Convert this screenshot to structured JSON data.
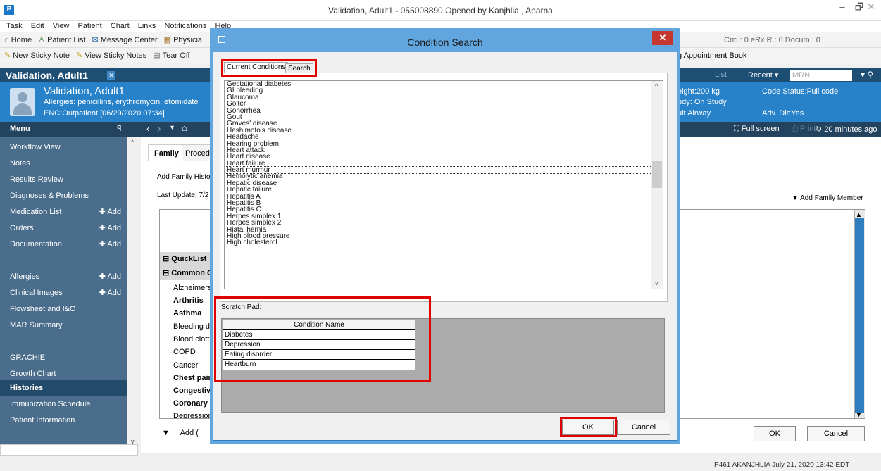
{
  "window": {
    "title": "Validation, Adult1 - 055008890 Opened by Kanjhlia , Aparna",
    "logo": "P",
    "minimize": "–",
    "restore": "🗗",
    "close": "✕"
  },
  "menubar": [
    "Task",
    "Edit",
    "View",
    "Patient",
    "Chart",
    "Links",
    "Notifications",
    "Help"
  ],
  "toolbar1": [
    "Home",
    "Patient List",
    "Message Center",
    "Physicia"
  ],
  "toolbar1_right": {
    "counts": "Criti.: 0  eRx R.: 0  Docum.: 0"
  },
  "toolbar2": [
    "New Sticky Note",
    "View Sticky Notes",
    "Tear Off"
  ],
  "toolbar2_right": "g Appointment Book",
  "patient": {
    "tab_name": "Validation, Adult1",
    "name": "Validation, Adult1",
    "allergies": "Allergies: penicillins, erythromycin, etomidate",
    "encounter": "ENC:Outpatient [06/29/2020 07:34]",
    "weight": "eight:200 kg",
    "study": "udy: On Study",
    "airway": "ult Airway",
    "code_status": "Code Status:Full code",
    "adv_dir": "Adv. Dir:Yes"
  },
  "search": {
    "list_label": "List",
    "recent_label": "Recent",
    "mrn_placeholder": "MRN"
  },
  "navbar": {
    "menu_label": "Menu",
    "fullscreen": "Full screen",
    "print": "Print",
    "refresh": "20 minutes ago"
  },
  "sidebar": [
    {
      "label": "Workflow View",
      "add": ""
    },
    {
      "label": "Notes",
      "add": ""
    },
    {
      "label": "Results Review",
      "add": ""
    },
    {
      "label": "Diagnoses & Problems",
      "add": ""
    },
    {
      "label": "Medication List",
      "add": "Add"
    },
    {
      "label": "Orders",
      "add": "Add"
    },
    {
      "label": "Documentation",
      "add": "Add"
    },
    {
      "label": "",
      "add": ""
    },
    {
      "label": "Allergies",
      "add": "Add"
    },
    {
      "label": "Clinical Images",
      "add": "Add"
    },
    {
      "label": "Flowsheet and I&O",
      "add": ""
    },
    {
      "label": "MAR Summary",
      "add": ""
    },
    {
      "label": "",
      "add": ""
    },
    {
      "label": "GRACHIE",
      "add": ""
    },
    {
      "label": "Growth Chart",
      "add": ""
    },
    {
      "label": "Histories",
      "add": "",
      "active": true
    },
    {
      "label": "Immunization Schedule",
      "add": ""
    },
    {
      "label": "Patient Information",
      "add": ""
    }
  ],
  "content": {
    "tabs": [
      "Family",
      "Proced"
    ],
    "add_history": "Add Family Histor",
    "last_update": "Last Update: 7/2",
    "add_member": "Add Family Member",
    "quicklist": "QuickList",
    "common": "Common C",
    "conditions": [
      "Alzheimers",
      "Arthritis",
      "Asthma",
      "Bleeding di",
      "Blood clott",
      "COPD",
      "Cancer",
      "Chest pain",
      "Congestive",
      "Coronary a",
      "Depression"
    ],
    "add_bottom": "Add (",
    "ok": "OK",
    "cancel": "Cancel"
  },
  "dialog": {
    "title": "Condition Search",
    "close": "✕",
    "tabs": [
      "Current Conditions",
      "Search"
    ],
    "conditions": [
      "Gestational diabetes",
      "GI bleeding",
      "Glaucoma",
      "Goiter",
      "Gonorrhea",
      "Gout",
      "Graves' disease",
      "Hashimoto's disease",
      "Headache",
      "Hearing problem",
      "Heart attack",
      "Heart disease",
      "Heart failure",
      "Heart murmur",
      "Hemolytic anemia",
      "Hepatic disease",
      "Hepatic failure",
      "Hepatitis A",
      "Hepatitis B",
      "Hepatitis C",
      "Herpes simplex 1",
      "Herpes simplex 2",
      "Hiatal hernia",
      "High blood pressure",
      "High cholesterol"
    ],
    "selected": "Heart murmur",
    "scratch_label": "Scratch Pad:",
    "scratch_header": "Condition Name",
    "scratch_items": [
      "Diabetes",
      "Depression",
      "Eating disorder",
      "Heartburn"
    ],
    "ok": "OK",
    "cancel": "Cancel"
  },
  "status": "P461  AKANJHLIA  July 21, 2020  13:42 EDT"
}
